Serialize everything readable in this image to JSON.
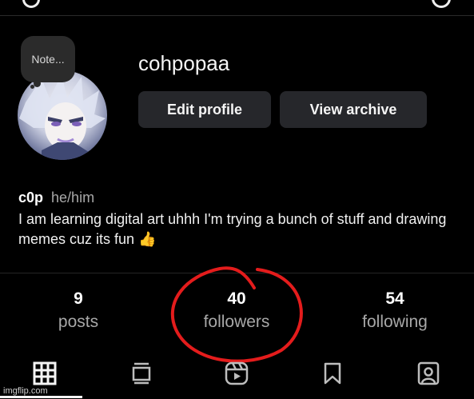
{
  "profile": {
    "note_label": "Note...",
    "username": "cohpopaa",
    "edit_profile_label": "Edit profile",
    "view_archive_label": "View archive",
    "display_name": "c0p",
    "pronouns": "he/him",
    "bio": "I am learning digital art uhhh I'm trying a bunch of stuff and drawing memes cuz its fun 👍"
  },
  "stats": [
    {
      "value": "9",
      "label": "posts"
    },
    {
      "value": "40",
      "label": "followers"
    },
    {
      "value": "54",
      "label": "following"
    }
  ],
  "tabs": [
    {
      "icon": "grid-icon",
      "active": true
    },
    {
      "icon": "feed-icon",
      "active": false
    },
    {
      "icon": "reels-icon",
      "active": false
    },
    {
      "icon": "bookmark-icon",
      "active": false
    },
    {
      "icon": "tagged-icon",
      "active": false
    }
  ],
  "watermark": "imgflip.com",
  "colors": {
    "background": "#000000",
    "button": "#26272b",
    "secondary_text": "#a8a8a8",
    "annotation": "#e41c1c"
  }
}
